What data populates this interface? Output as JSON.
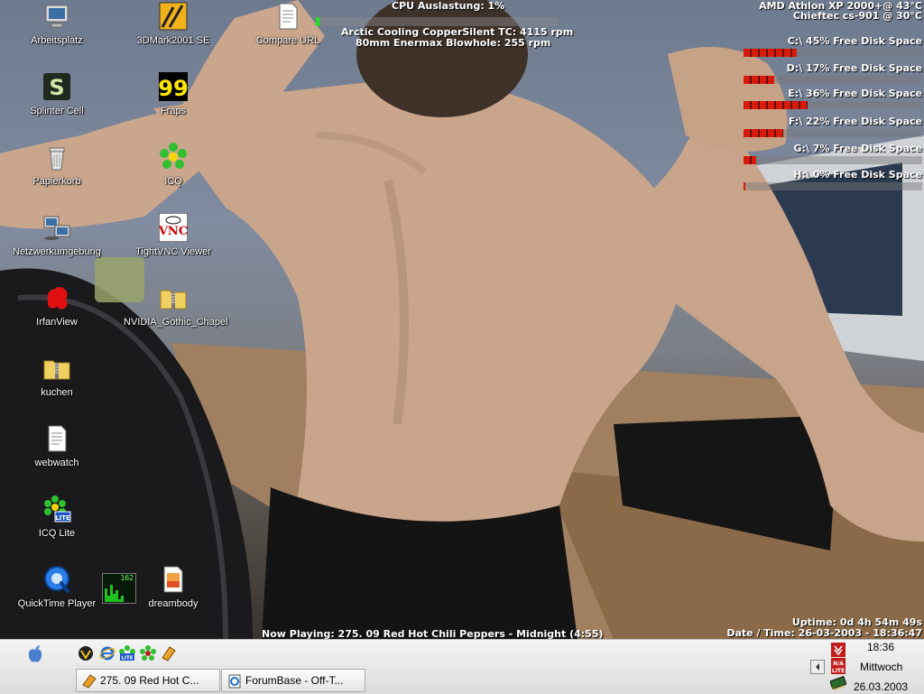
{
  "desktop": {
    "icons": [
      {
        "label": "Arbeitsplatz",
        "icon": "computer-icon"
      },
      {
        "label": "Splinter Cell",
        "icon": "splinter-cell-icon"
      },
      {
        "label": "Papierkorb",
        "icon": "recycle-bin-icon"
      },
      {
        "label": "Netzwerkumgebung",
        "icon": "network-icon"
      },
      {
        "label": "IrfanView",
        "icon": "irfanview-icon"
      },
      {
        "label": "kuchen",
        "icon": "zip-folder-icon"
      },
      {
        "label": "webwatch",
        "icon": "text-file-icon"
      },
      {
        "label": "ICQ Lite",
        "icon": "icq-lite-icon"
      },
      {
        "label": "QuickTime Player",
        "icon": "quicktime-icon"
      },
      {
        "label": "3DMark2001 SE",
        "icon": "3dmark-icon"
      },
      {
        "label": "Fraps",
        "icon": "fraps-icon"
      },
      {
        "label": "ICQ",
        "icon": "icq-icon"
      },
      {
        "label": "TightVNC Viewer",
        "icon": "vnc-icon"
      },
      {
        "label": "NVIDIA_Gothic_Chapel",
        "icon": "zip-folder-icon"
      },
      {
        "label": "Compare URL",
        "icon": "text-file-icon"
      },
      {
        "label": "dreambody",
        "icon": "image-file-icon"
      }
    ],
    "monitor_widget_value": "162"
  },
  "overlay": {
    "cpu_load": "CPU Auslastung: 1%",
    "cpu_load_fraction": 0.01,
    "fan1": "Arctic Cooling CopperSilent TC: 4115 rpm",
    "fan2": "80mm Enermax Blowhole: 255 rpm",
    "cpu_temp": "AMD Athlon XP 2000+@ 43°C",
    "case_temp": "Chieftec cs-901 @ 30°C",
    "now_playing": "Now Playing: 275. 09 Red Hot Chili Peppers - Midnight (4:55)",
    "uptime": "Uptime: 0d 4h 54m 49s",
    "datetime": "Date / Time: 26-03-2003 - 18:36:47"
  },
  "disks": [
    {
      "label": "C:\\ 45% Free Disk Space",
      "used_fraction": 0.3
    },
    {
      "label": "D:\\ 17% Free Disk Space",
      "used_fraction": 0.17
    },
    {
      "label": "E:\\ 36% Free Disk Space",
      "used_fraction": 0.36
    },
    {
      "label": "F:\\ 22% Free Disk Space",
      "used_fraction": 0.22
    },
    {
      "label": "G:\\ 7% Free Disk Space",
      "used_fraction": 0.07
    },
    {
      "label": "H:\\ 0% Free Disk Space",
      "used_fraction": 0.01
    }
  ],
  "taskbar": {
    "quick_launch": [
      "apple-icon",
      "winamp-icon",
      "ie-icon",
      "icq-lite-icon",
      "icq-icon",
      "winamp-small-icon"
    ],
    "tasks": [
      {
        "label": "275. 09 Red Hot C...",
        "icon": "winamp-icon"
      },
      {
        "label": "ForumBase - Off-T...",
        "icon": "ie-page-icon"
      }
    ],
    "clock_time": "18:36",
    "day": "Mittwoch",
    "date": "26.03.2003"
  },
  "colors": {
    "disk_bar": "#d61b0c",
    "cpu_bar": "#22dd22",
    "text": "#ffffff"
  }
}
